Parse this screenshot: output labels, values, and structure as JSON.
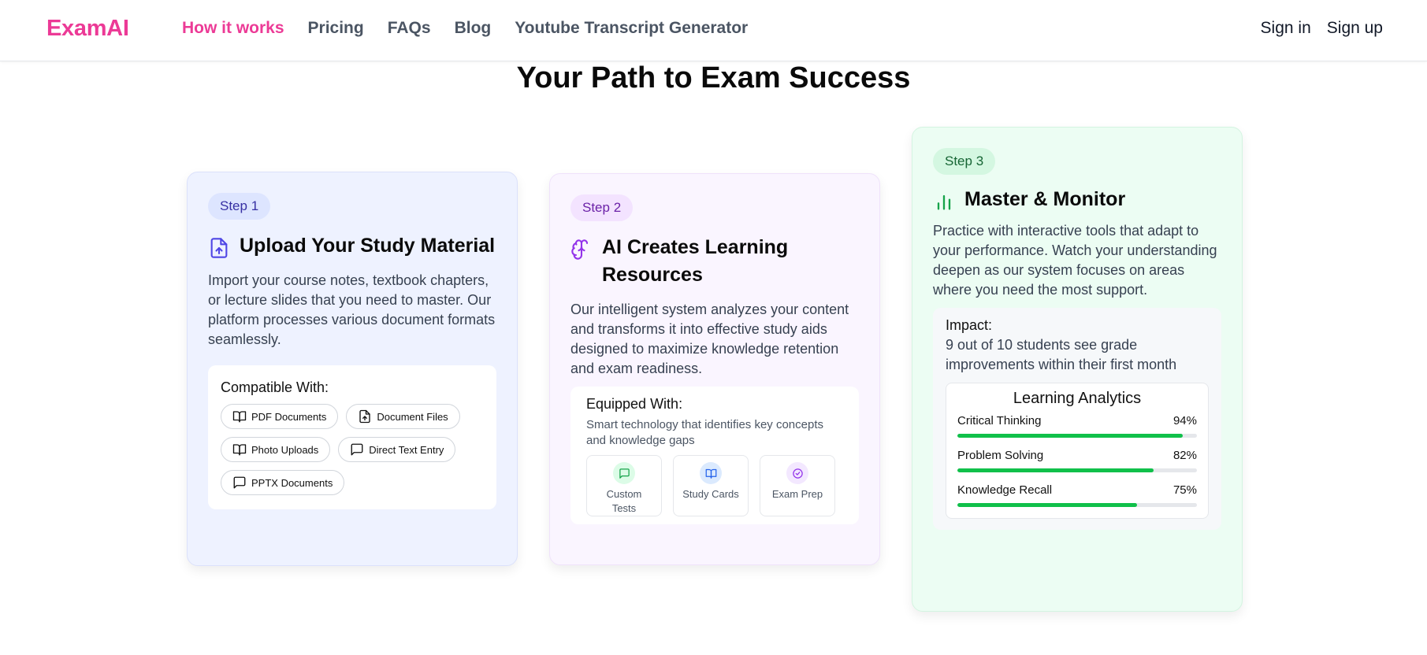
{
  "header": {
    "logo": "ExamAI",
    "nav": [
      "How it works",
      "Pricing",
      "FAQs",
      "Blog",
      "Youtube Transcript Generator"
    ],
    "active_index": 0,
    "sign_in": "Sign in",
    "sign_up": "Sign up"
  },
  "page_title": "Your Path to Exam Success",
  "steps": [
    {
      "badge": "Step 1",
      "icon": "file-upload-icon",
      "title": "Upload Your Study Material",
      "description": "Import your course notes, textbook chapters, or lecture slides that you need to master. Our platform processes various document formats seamlessly.",
      "section_title": "Compatible With:",
      "chips": [
        {
          "label": "PDF Documents",
          "icon": "book-open-icon"
        },
        {
          "label": "Document Files",
          "icon": "file-upload-icon"
        },
        {
          "label": "Photo Uploads",
          "icon": "book-open-icon"
        },
        {
          "label": "Direct Text Entry",
          "icon": "message-square-icon"
        },
        {
          "label": "PPTX Documents",
          "icon": "message-square-icon"
        }
      ]
    },
    {
      "badge": "Step 2",
      "icon": "brain-icon",
      "title": "AI Creates Learning Resources",
      "description": "Our intelligent system analyzes your content and transforms it into effective study aids designed to maximize knowledge retention and exam readiness.",
      "section_title": "Equipped With:",
      "section_desc": "Smart technology that identifies key concepts and knowledge gaps",
      "tools": [
        {
          "label": "Custom Tests",
          "icon": "message-square-icon",
          "color": "#16a34a",
          "bg": "#dcfce7"
        },
        {
          "label": "Study Cards",
          "icon": "book-open-icon",
          "color": "#2563eb",
          "bg": "#dbeafe"
        },
        {
          "label": "Exam Prep",
          "icon": "check-circle-icon",
          "color": "#9333ea",
          "bg": "#f3e8ff"
        }
      ]
    },
    {
      "badge": "Step 3",
      "icon": "bar-chart-icon",
      "title": "Master & Monitor",
      "description": "Practice with interactive tools that adapt to your performance. Watch your understanding deepen as our system focuses on areas where you need the most support.",
      "impact_title": "Impact:",
      "impact_text": "9 out of 10 students see grade improvements within their first month",
      "analytics_title": "Learning Analytics",
      "metrics": [
        {
          "label": "Critical Thinking",
          "value": "94%",
          "fraction": 0.94
        },
        {
          "label": "Problem Solving",
          "value": "82%",
          "fraction": 0.82
        },
        {
          "label": "Knowledge Recall",
          "value": "75%",
          "fraction": 0.75
        }
      ]
    }
  ],
  "colors": {
    "brand": "#ec3a96",
    "step1_accent": "#4f46e5",
    "step2_accent": "#9333ea",
    "step3_accent": "#16a34a",
    "progress": "#10c04a"
  }
}
